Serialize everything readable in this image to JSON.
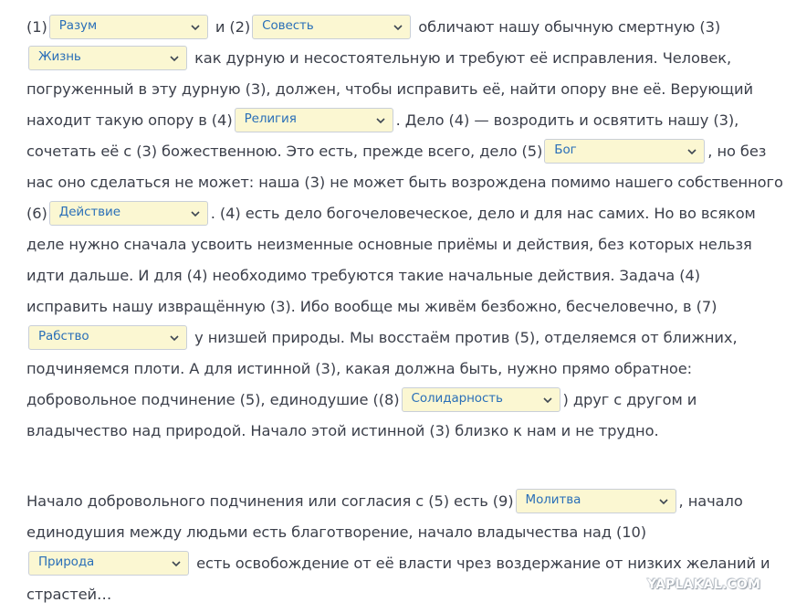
{
  "paragraph1": {
    "t1": "(1)",
    "t2": "и (2)",
    "t3": "обличают нашу обычную смертную",
    "t4": "(3)",
    "t5": "как дурную и несостоятельную и требуют её исправления. Человек, погруженный в эту дурную (3), должен, чтобы исправить её, найти опору вне её. Верующий находит такую опору в (4)",
    "t6": ". Дело (4) — возродить и освятить нашу (3), сочетать её с (3) божественною. Это есть, прежде всего, дело",
    "t7": "(5)",
    "t8": ", но без нас оно сделаться не может: наша (3) не может быть возрождена помимо нашего собственного (6)",
    "t9": ". (4) есть дело богочеловеческое, дело и для нас самих. Но во всяком деле нужно сначала усвоить неизменные основные приёмы и действия, без которых нельзя идти дальше. И для (4) необходимо требуются такие начальные действия. Задача (4) исправить нашу извращённую (3). Ибо вообще мы живём безбожно, бесчеловечно, в",
    "t10": "(7)",
    "t11": "у низшей природы. Мы восстаём против (5), отделяемся от ближних, подчиняемся плоти. А для истинной (3), какая должна быть, нужно прямо обратное: добровольное подчинение (5), единодушие ((8)",
    "t12": ") друг с другом и владычество над природой. Начало этой истинной (3) близко к нам и не трудно."
  },
  "paragraph2": {
    "t1": "Начало добровольного подчинения или согласия с (5) есть (9)",
    "t2": ", начало единодушия между людьми есть благотворение, начало владычества над",
    "t3": "(10)",
    "t4": "есть освобождение от её власти чрез воздержание от низких желаний и страстей…"
  },
  "dropdowns": {
    "d1": "Разум",
    "d2": "Совесть",
    "d3": "Жизнь",
    "d4": "Религия",
    "d5": "Бог",
    "d6": "Действие",
    "d7": "Рабство",
    "d8": "Солидарность",
    "d9": "Молитва",
    "d10": "Природа"
  },
  "dropdown_icon": "chevron-down-icon",
  "watermark": "YAPLAKAL.COM",
  "colors": {
    "text": "#3b3f4a",
    "dropdown_bg": "#fbf7d2",
    "dropdown_border": "#c9cfd8",
    "dropdown_text": "#2a6fb8"
  }
}
